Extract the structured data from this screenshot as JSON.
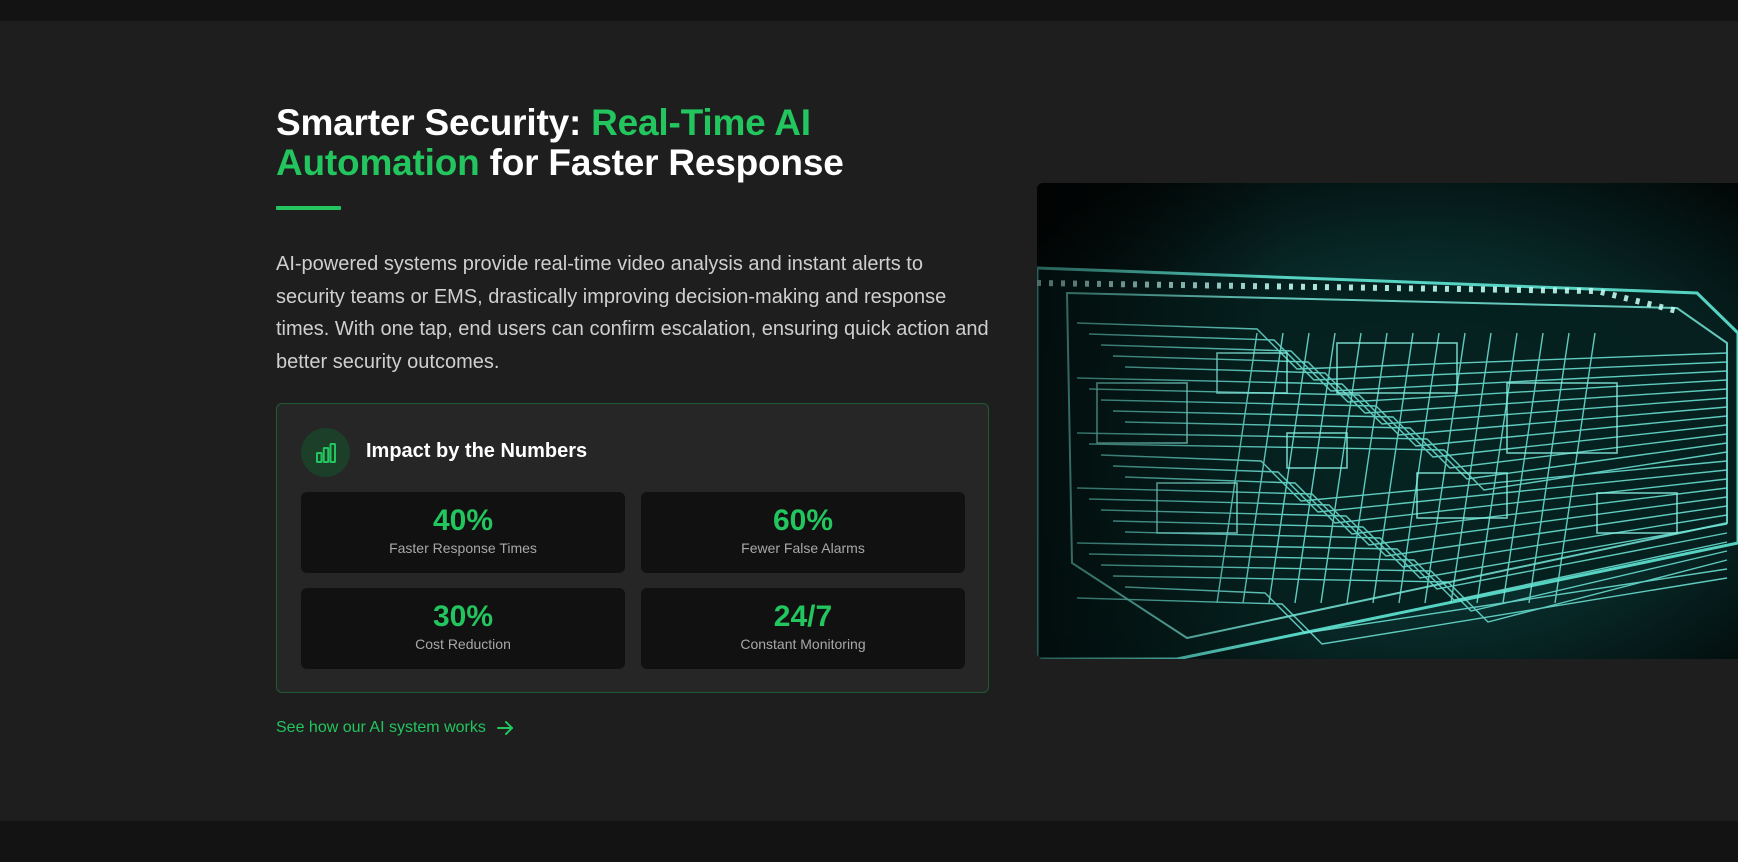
{
  "headline": {
    "part1": "Smarter Security: ",
    "accent": "Real-Time AI Automation",
    "part2": " for Faster Response"
  },
  "description": "AI-powered systems provide real-time video analysis and instant alerts to security teams or EMS, drastically improving decision-making and response times. With one tap, end users can confirm escalation, ensuring quick action and better security outcomes.",
  "impact": {
    "title": "Impact by the Numbers",
    "icon": "bar-chart-icon",
    "stats": [
      {
        "value": "40%",
        "label": "Faster Response Times"
      },
      {
        "value": "60%",
        "label": "Fewer False Alarms"
      },
      {
        "value": "30%",
        "label": "Cost Reduction"
      },
      {
        "value": "24/7",
        "label": "Constant Monitoring"
      }
    ]
  },
  "cta": {
    "label": "See how our AI system works",
    "icon": "arrow-right-icon"
  },
  "image": {
    "icon": "circuit-board-image"
  },
  "colors": {
    "accent": "#22c55e",
    "background": "#1e1e1e",
    "page_background": "#131313",
    "card_background": "#262626",
    "stat_background": "#111111",
    "image_glow": "#5fe6d4"
  }
}
